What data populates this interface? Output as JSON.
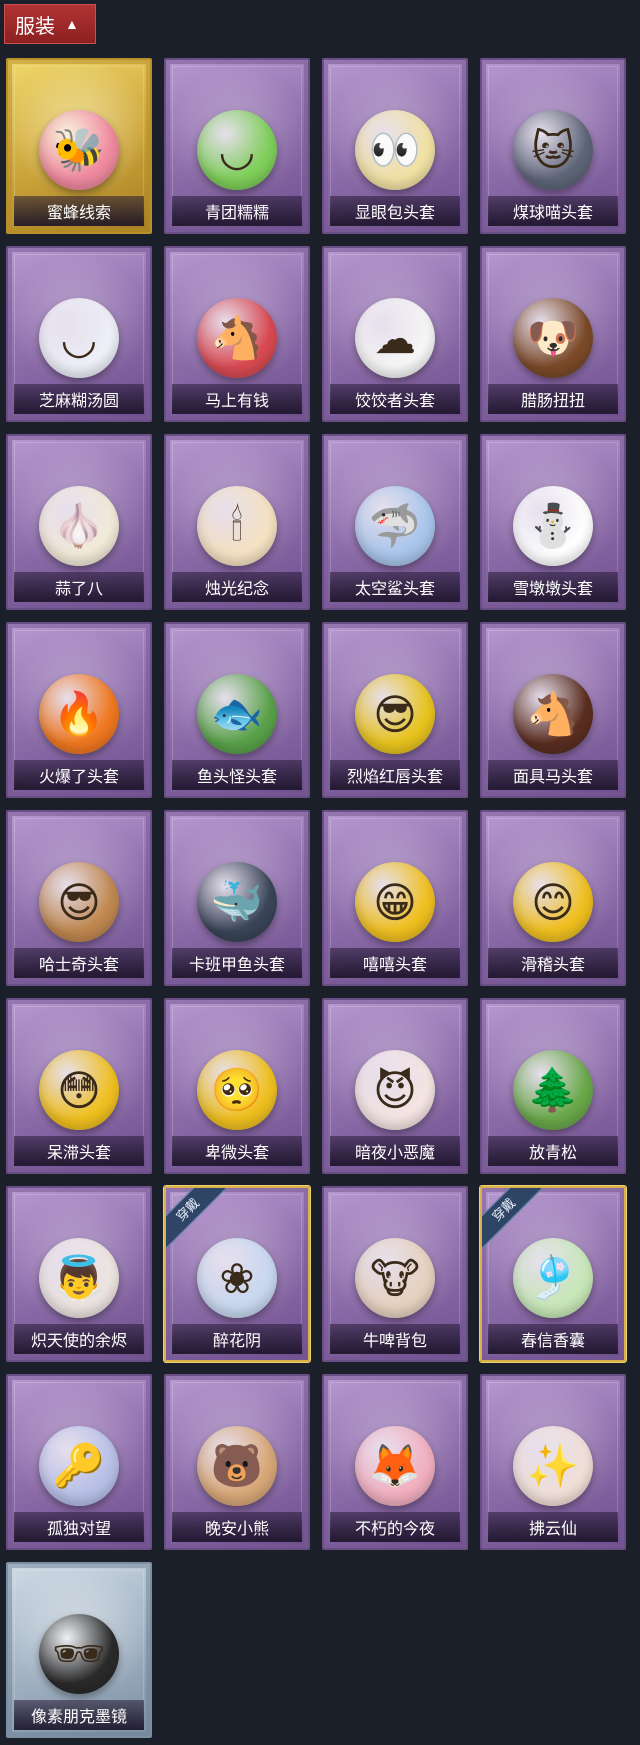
{
  "header": {
    "title": "服装",
    "caret_icon": "chevron-up-icon"
  },
  "equipped_ribbon_label": "穿戴",
  "items": [
    {
      "label": "蜜蜂线索",
      "icon": "pink-bear-bee-costume",
      "glyph": "🐝",
      "color": "#f08aa0",
      "frame": "gold",
      "equipped": false
    },
    {
      "label": "青团糯糯",
      "icon": "green-dumpling-head",
      "glyph": "◡",
      "color": "#7fcf5a",
      "frame": "purple",
      "equipped": false
    },
    {
      "label": "显眼包头套",
      "icon": "lightbulb-head",
      "glyph": "👀",
      "color": "#f2e2a4",
      "frame": "purple",
      "equipped": false
    },
    {
      "label": "煤球喵头套",
      "icon": "gray-cat-head",
      "glyph": "🐱",
      "color": "#5e6678",
      "frame": "purple",
      "equipped": false
    },
    {
      "label": "芝麻糊汤圆",
      "icon": "white-rice-ball-head",
      "glyph": "◡",
      "color": "#eef0f8",
      "frame": "purple",
      "equipped": false
    },
    {
      "label": "马上有钱",
      "icon": "red-horse-head",
      "glyph": "🐴",
      "color": "#d94a52",
      "frame": "purple",
      "equipped": false
    },
    {
      "label": "饺饺者头套",
      "icon": "cloud-dumpling-head",
      "glyph": "☁",
      "color": "#f6f6f6",
      "frame": "purple",
      "equipped": false
    },
    {
      "label": "腊肠扭扭",
      "icon": "dachshund-head",
      "glyph": "🐶",
      "color": "#7b4a28",
      "frame": "purple",
      "equipped": false
    },
    {
      "label": "蒜了八",
      "icon": "garlic-head",
      "glyph": "🧄",
      "color": "#f2ead8",
      "frame": "purple",
      "equipped": false
    },
    {
      "label": "烛光纪念",
      "icon": "candle-head",
      "glyph": "🕯",
      "color": "#f5e2c2",
      "frame": "purple",
      "equipped": false
    },
    {
      "label": "太空鲨头套",
      "icon": "shark-head",
      "glyph": "🦈",
      "color": "#a9c6ec",
      "frame": "purple",
      "equipped": false
    },
    {
      "label": "雪墩墩头套",
      "icon": "snowman-head",
      "glyph": "⛄",
      "color": "#ffffff",
      "frame": "purple",
      "equipped": false
    },
    {
      "label": "火爆了头套",
      "icon": "fire-head",
      "glyph": "🔥",
      "color": "#f07820",
      "frame": "purple",
      "equipped": false
    },
    {
      "label": "鱼头怪头套",
      "icon": "fish-head",
      "glyph": "🐟",
      "color": "#5aa24a",
      "frame": "purple",
      "equipped": false
    },
    {
      "label": "烈焰红唇头套",
      "icon": "yellow-mouse-head",
      "glyph": "😎",
      "color": "#e8c41e",
      "frame": "purple",
      "equipped": false
    },
    {
      "label": "面具马头套",
      "icon": "horse-mask-head",
      "glyph": "🐴",
      "color": "#5a2e20",
      "frame": "purple",
      "equipped": false
    },
    {
      "label": "哈士奇头套",
      "icon": "husky-head",
      "glyph": "😎",
      "color": "#c08850",
      "frame": "purple",
      "equipped": false
    },
    {
      "label": "卡班甲鱼头套",
      "icon": "whale-head",
      "glyph": "🐳",
      "color": "#3a4558",
      "frame": "purple",
      "equipped": false
    },
    {
      "label": "嘻嘻头套",
      "icon": "grin-emoji-head",
      "glyph": "😁",
      "color": "#f0c020",
      "frame": "purple",
      "equipped": false
    },
    {
      "label": "滑稽头套",
      "icon": "funny-emoji-head",
      "glyph": "😊",
      "color": "#f0c020",
      "frame": "purple",
      "equipped": false
    },
    {
      "label": "呆滞头套",
      "icon": "stunned-emoji-head",
      "glyph": "😳",
      "color": "#f0c020",
      "frame": "purple",
      "equipped": false
    },
    {
      "label": "卑微头套",
      "icon": "humble-emoji-head",
      "glyph": "🥺",
      "color": "#f0c020",
      "frame": "purple",
      "equipped": false
    },
    {
      "label": "暗夜小恶魔",
      "icon": "devil-bust",
      "glyph": "😈",
      "color": "#f4e4e2",
      "frame": "purple",
      "equipped": false
    },
    {
      "label": "放青松",
      "icon": "potted-pine",
      "glyph": "🌲",
      "color": "#6aa84a",
      "frame": "purple",
      "equipped": false
    },
    {
      "label": "炽天使的余烬",
      "icon": "angel-figure",
      "glyph": "👼",
      "color": "#ece4e0",
      "frame": "purple",
      "equipped": false
    },
    {
      "label": "醉花阴",
      "icon": "flower-ornament",
      "glyph": "❀",
      "color": "#c8d8f0",
      "frame": "purple",
      "equipped": true
    },
    {
      "label": "牛啤背包",
      "icon": "cow-beer-barrel",
      "glyph": "🐮",
      "color": "#e6d2c0",
      "frame": "purple",
      "equipped": false
    },
    {
      "label": "春信香囊",
      "icon": "scent-pouch",
      "glyph": "🎐",
      "color": "#c8e8b8",
      "frame": "purple",
      "equipped": true
    },
    {
      "label": "孤独对望",
      "icon": "keychain-figure",
      "glyph": "🔑",
      "color": "#b8c0e8",
      "frame": "purple",
      "equipped": false
    },
    {
      "label": "晚安小熊",
      "icon": "bear-keychain",
      "glyph": "🐻",
      "color": "#d8a878",
      "frame": "purple",
      "equipped": false
    },
    {
      "label": "不朽的今夜",
      "icon": "fox-cup",
      "glyph": "🦊",
      "color": "#f2b0c0",
      "frame": "purple",
      "equipped": false
    },
    {
      "label": "拂云仙",
      "icon": "fairy-keychain",
      "glyph": "✨",
      "color": "#f0e0d8",
      "frame": "purple",
      "equipped": false
    },
    {
      "label": "像素朋克墨镜",
      "icon": "pixel-sunglasses",
      "glyph": "🕶",
      "color": "#2a2a2a",
      "frame": "silver",
      "equipped": false
    }
  ]
}
